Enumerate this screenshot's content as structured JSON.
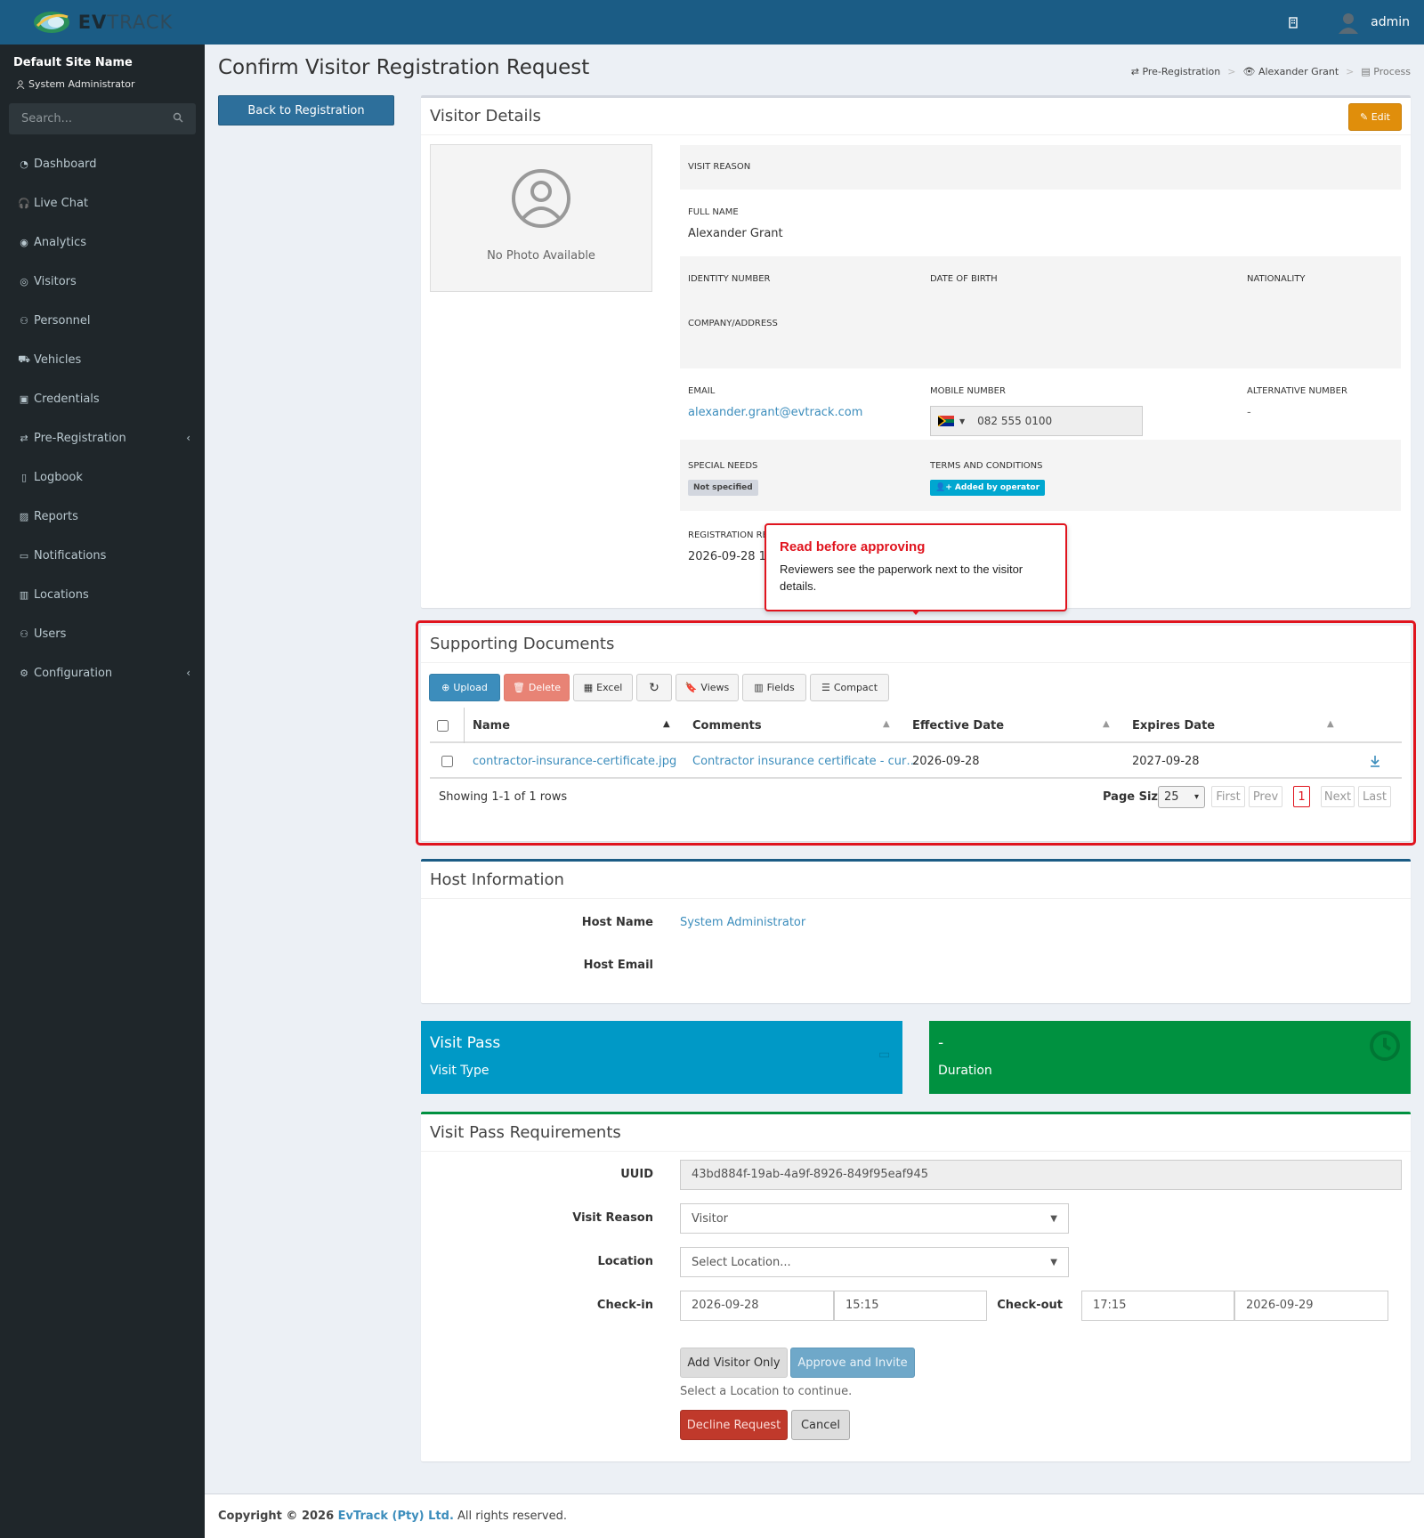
{
  "app": {
    "brand_main": "EV",
    "brand_rest": "TRACK",
    "user": "admin"
  },
  "sidebar": {
    "site_name": "Default Site Name",
    "role": "System Administrator",
    "search_placeholder": "Search...",
    "items": [
      {
        "label": "Dashboard",
        "icon": "dashboard-icon"
      },
      {
        "label": "Live Chat",
        "icon": "headset-icon"
      },
      {
        "label": "Analytics",
        "icon": "analytics-icon"
      },
      {
        "label": "Visitors",
        "icon": "eye-icon"
      },
      {
        "label": "Personnel",
        "icon": "personnel-icon"
      },
      {
        "label": "Vehicles",
        "icon": "car-icon"
      },
      {
        "label": "Credentials",
        "icon": "credentials-icon"
      },
      {
        "label": "Pre-Registration",
        "icon": "exchange-icon",
        "arrow": "‹"
      },
      {
        "label": "Logbook",
        "icon": "book-icon"
      },
      {
        "label": "Reports",
        "icon": "reports-icon"
      },
      {
        "label": "Notifications",
        "icon": "notifications-icon"
      },
      {
        "label": "Locations",
        "icon": "locations-icon"
      },
      {
        "label": "Users",
        "icon": "users-icon"
      },
      {
        "label": "Configuration",
        "icon": "gear-icon",
        "arrow": "‹"
      }
    ]
  },
  "page": {
    "title": "Confirm Visitor Registration Request",
    "back_button": "Back to Registration"
  },
  "breadcrumb": {
    "pre_registration": "Pre-Registration",
    "person": "Alexander Grant",
    "process": "Process"
  },
  "visitor_details": {
    "title": "Visitor Details",
    "edit": "Edit",
    "no_photo": "No Photo Available",
    "visit_reason_label": "Visit Reason",
    "full_name_label": "Full Name",
    "full_name": "Alexander Grant",
    "identity_label": "Identity Number",
    "dob_label": "Date of Birth",
    "nationality_label": "Nationality",
    "company_label": "Company/Address",
    "email_label": "Email",
    "email": "alexander.grant@evtrack.com",
    "mobile_label": "Mobile Number",
    "mobile": "082 555 0100",
    "alt_label": "Alternative Number",
    "alt": "-",
    "special_label": "Special Needs",
    "special": "Not specified",
    "terms_label": "Terms and Conditions",
    "terms": "Added by operator",
    "reg_label": "Registration Re",
    "reg_value": "2026-09-28 15:"
  },
  "tooltip": {
    "title": "Read before approving",
    "body": "Reviewers see the paperwork next to the visitor details."
  },
  "documents": {
    "title": "Supporting Documents",
    "toolbar": {
      "upload": "Upload",
      "delete": "Delete",
      "excel": "Excel",
      "views": "Views",
      "fields": "Fields",
      "compact": "Compact"
    },
    "columns": [
      "Name",
      "Comments",
      "Effective Date",
      "Expires Date"
    ],
    "rows": [
      {
        "name": "contractor-insurance-certificate.jpg",
        "comments": "Contractor insurance certificate - cur…",
        "effective": "2026-09-28",
        "expires": "2027-09-28"
      }
    ],
    "showing": "Showing 1-1 of 1 rows",
    "page_size_label": "Page Size",
    "page_size": "25",
    "pager": {
      "first": "First",
      "prev": "Prev",
      "current": "1",
      "next": "Next",
      "last": "Last"
    }
  },
  "host": {
    "title": "Host Information",
    "name_label": "Host Name",
    "name": "System Administrator",
    "email_label": "Host Email"
  },
  "cards": {
    "visit_pass": "Visit Pass",
    "visit_type": "Visit Type",
    "duration_value": "-",
    "duration": "Duration",
    "blue": "#0099c6",
    "green": "#009140"
  },
  "requirements": {
    "title": "Visit Pass Requirements",
    "uuid_label": "UUID",
    "uuid": "43bd884f-19ab-4a9f-8926-849f95eaf945",
    "reason_label": "Visit Reason",
    "reason": "Visitor",
    "location_label": "Location",
    "location": "Select Location...",
    "checkin_label": "Check-in",
    "checkin_date": "2026-09-28",
    "checkin_time": "15:15",
    "checkout_label": "Check-out",
    "checkout_time": "17:15",
    "checkout_date": "2026-09-29",
    "add_only": "Add Visitor Only",
    "approve": "Approve and Invite",
    "hint": "Select a Location to continue.",
    "decline": "Decline Request",
    "cancel": "Cancel"
  },
  "footer": {
    "prefix": "Copyright © 2026 ",
    "company": "EvTrack (Pty) Ltd.",
    "suffix": " All rights reserved."
  }
}
